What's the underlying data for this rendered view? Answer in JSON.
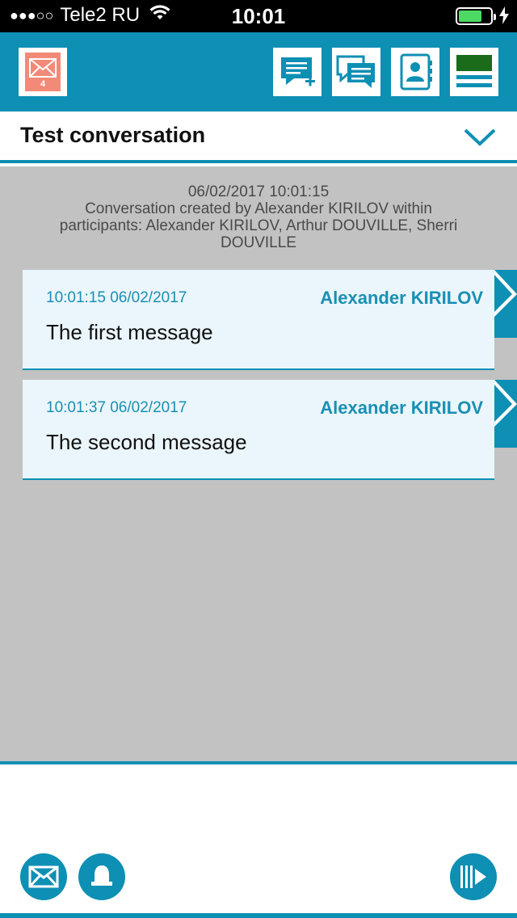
{
  "status_bar": {
    "signal": "●●●○○",
    "carrier": "Tele2 RU",
    "time": "10:01"
  },
  "toolbar": {
    "unread_count": "4"
  },
  "conversation": {
    "title": "Test conversation",
    "created_timestamp": "06/02/2017 10:01:15",
    "created_info": "Conversation created by Alexander KIRILOV within participants: Alexander KIRILOV, Arthur DOUVILLE, Sherri DOUVILLE"
  },
  "messages": [
    {
      "time": "10:01:15 06/02/2017",
      "author": "Alexander KIRILOV",
      "text": "The first message"
    },
    {
      "time": "10:01:37 06/02/2017",
      "author": "Alexander KIRILOV",
      "text": "The second message"
    }
  ],
  "colors": {
    "accent": "#0e8fb4",
    "message_bg": "#eaf6fc",
    "content_bg": "#c2c2c2",
    "badge": "#f38a77"
  }
}
